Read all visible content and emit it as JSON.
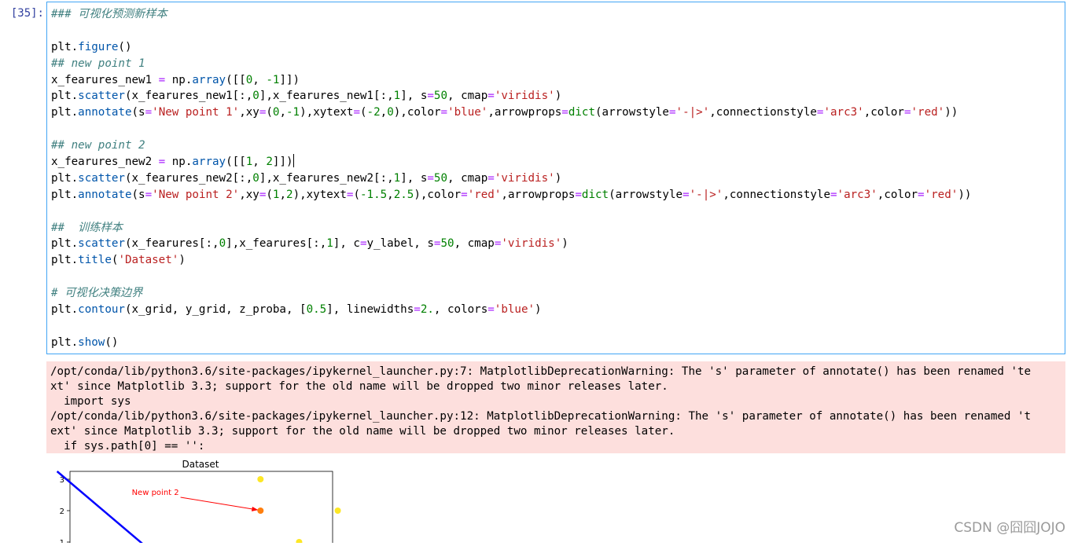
{
  "cell": {
    "prompt": "[35]:",
    "lines": [
      [
        {
          "t": "### 可视化预测新样本",
          "c": "cm"
        }
      ],
      [],
      [
        {
          "t": "plt.",
          "c": ""
        },
        {
          "t": "figure",
          "c": "fn"
        },
        {
          "t": "()",
          "c": ""
        }
      ],
      [
        {
          "t": "## new point 1",
          "c": "cm"
        }
      ],
      [
        {
          "t": "x_fearures_new1 ",
          "c": ""
        },
        {
          "t": "=",
          "c": "op"
        },
        {
          "t": " np.",
          "c": ""
        },
        {
          "t": "array",
          "c": "fn"
        },
        {
          "t": "([[",
          "c": ""
        },
        {
          "t": "0",
          "c": "num"
        },
        {
          "t": ", ",
          "c": ""
        },
        {
          "t": "-1",
          "c": "num"
        },
        {
          "t": "]])",
          "c": ""
        }
      ],
      [
        {
          "t": "plt.",
          "c": ""
        },
        {
          "t": "scatter",
          "c": "fn"
        },
        {
          "t": "(x_fearures_new1[:,",
          "c": ""
        },
        {
          "t": "0",
          "c": "num"
        },
        {
          "t": "],x_fearures_new1[:,",
          "c": ""
        },
        {
          "t": "1",
          "c": "num"
        },
        {
          "t": "], s",
          "c": ""
        },
        {
          "t": "=",
          "c": "op"
        },
        {
          "t": "50",
          "c": "num"
        },
        {
          "t": ", cmap",
          "c": ""
        },
        {
          "t": "=",
          "c": "op"
        },
        {
          "t": "'viridis'",
          "c": "str"
        },
        {
          "t": ")",
          "c": ""
        }
      ],
      [
        {
          "t": "plt.",
          "c": ""
        },
        {
          "t": "annotate",
          "c": "fn"
        },
        {
          "t": "(s",
          "c": ""
        },
        {
          "t": "=",
          "c": "op"
        },
        {
          "t": "'New point 1'",
          "c": "str"
        },
        {
          "t": ",xy",
          "c": ""
        },
        {
          "t": "=",
          "c": "op"
        },
        {
          "t": "(",
          "c": ""
        },
        {
          "t": "0",
          "c": "num"
        },
        {
          "t": ",",
          "c": ""
        },
        {
          "t": "-1",
          "c": "num"
        },
        {
          "t": "),xytext",
          "c": ""
        },
        {
          "t": "=",
          "c": "op"
        },
        {
          "t": "(",
          "c": ""
        },
        {
          "t": "-2",
          "c": "num"
        },
        {
          "t": ",",
          "c": ""
        },
        {
          "t": "0",
          "c": "num"
        },
        {
          "t": "),color",
          "c": ""
        },
        {
          "t": "=",
          "c": "op"
        },
        {
          "t": "'blue'",
          "c": "str"
        },
        {
          "t": ",arrowprops",
          "c": ""
        },
        {
          "t": "=",
          "c": "op"
        },
        {
          "t": "dict",
          "c": "kw"
        },
        {
          "t": "(arrowstyle",
          "c": ""
        },
        {
          "t": "=",
          "c": "op"
        },
        {
          "t": "'-|>'",
          "c": "str"
        },
        {
          "t": ",connectionstyle",
          "c": ""
        },
        {
          "t": "=",
          "c": "op"
        },
        {
          "t": "'arc3'",
          "c": "str"
        },
        {
          "t": ",color",
          "c": ""
        },
        {
          "t": "=",
          "c": "op"
        },
        {
          "t": "'red'",
          "c": "str"
        },
        {
          "t": "))",
          "c": ""
        }
      ],
      [],
      [
        {
          "t": "## new point 2",
          "c": "cm"
        }
      ],
      [
        {
          "t": "x_fearures_new2 ",
          "c": ""
        },
        {
          "t": "=",
          "c": "op"
        },
        {
          "t": " np.",
          "c": ""
        },
        {
          "t": "array",
          "c": "fn"
        },
        {
          "t": "([[",
          "c": ""
        },
        {
          "t": "1",
          "c": "num"
        },
        {
          "t": ", ",
          "c": ""
        },
        {
          "t": "2",
          "c": "num"
        },
        {
          "t": "]])",
          "c": ""
        },
        {
          "t": "",
          "c": "cursor"
        }
      ],
      [
        {
          "t": "plt.",
          "c": ""
        },
        {
          "t": "scatter",
          "c": "fn"
        },
        {
          "t": "(x_fearures_new2[:,",
          "c": ""
        },
        {
          "t": "0",
          "c": "num"
        },
        {
          "t": "],x_fearures_new2[:,",
          "c": ""
        },
        {
          "t": "1",
          "c": "num"
        },
        {
          "t": "], s",
          "c": ""
        },
        {
          "t": "=",
          "c": "op"
        },
        {
          "t": "50",
          "c": "num"
        },
        {
          "t": ", cmap",
          "c": ""
        },
        {
          "t": "=",
          "c": "op"
        },
        {
          "t": "'viridis'",
          "c": "str"
        },
        {
          "t": ")",
          "c": ""
        }
      ],
      [
        {
          "t": "plt.",
          "c": ""
        },
        {
          "t": "annotate",
          "c": "fn"
        },
        {
          "t": "(s",
          "c": ""
        },
        {
          "t": "=",
          "c": "op"
        },
        {
          "t": "'New point 2'",
          "c": "str"
        },
        {
          "t": ",xy",
          "c": ""
        },
        {
          "t": "=",
          "c": "op"
        },
        {
          "t": "(",
          "c": ""
        },
        {
          "t": "1",
          "c": "num"
        },
        {
          "t": ",",
          "c": ""
        },
        {
          "t": "2",
          "c": "num"
        },
        {
          "t": "),xytext",
          "c": ""
        },
        {
          "t": "=",
          "c": "op"
        },
        {
          "t": "(",
          "c": ""
        },
        {
          "t": "-1.5",
          "c": "num"
        },
        {
          "t": ",",
          "c": ""
        },
        {
          "t": "2.5",
          "c": "num"
        },
        {
          "t": "),color",
          "c": ""
        },
        {
          "t": "=",
          "c": "op"
        },
        {
          "t": "'red'",
          "c": "str"
        },
        {
          "t": ",arrowprops",
          "c": ""
        },
        {
          "t": "=",
          "c": "op"
        },
        {
          "t": "dict",
          "c": "kw"
        },
        {
          "t": "(arrowstyle",
          "c": ""
        },
        {
          "t": "=",
          "c": "op"
        },
        {
          "t": "'-|>'",
          "c": "str"
        },
        {
          "t": ",connectionstyle",
          "c": ""
        },
        {
          "t": "=",
          "c": "op"
        },
        {
          "t": "'arc3'",
          "c": "str"
        },
        {
          "t": ",color",
          "c": ""
        },
        {
          "t": "=",
          "c": "op"
        },
        {
          "t": "'red'",
          "c": "str"
        },
        {
          "t": "))",
          "c": ""
        }
      ],
      [],
      [
        {
          "t": "##  训练样本",
          "c": "cm"
        }
      ],
      [
        {
          "t": "plt.",
          "c": ""
        },
        {
          "t": "scatter",
          "c": "fn"
        },
        {
          "t": "(x_fearures[:,",
          "c": ""
        },
        {
          "t": "0",
          "c": "num"
        },
        {
          "t": "],x_fearures[:,",
          "c": ""
        },
        {
          "t": "1",
          "c": "num"
        },
        {
          "t": "], c",
          "c": ""
        },
        {
          "t": "=",
          "c": "op"
        },
        {
          "t": "y_label, s",
          "c": ""
        },
        {
          "t": "=",
          "c": "op"
        },
        {
          "t": "50",
          "c": "num"
        },
        {
          "t": ", cmap",
          "c": ""
        },
        {
          "t": "=",
          "c": "op"
        },
        {
          "t": "'viridis'",
          "c": "str"
        },
        {
          "t": ")",
          "c": ""
        }
      ],
      [
        {
          "t": "plt.",
          "c": ""
        },
        {
          "t": "title",
          "c": "fn"
        },
        {
          "t": "(",
          "c": ""
        },
        {
          "t": "'Dataset'",
          "c": "str"
        },
        {
          "t": ")",
          "c": ""
        }
      ],
      [],
      [
        {
          "t": "# 可视化决策边界",
          "c": "cm"
        }
      ],
      [
        {
          "t": "plt.",
          "c": ""
        },
        {
          "t": "contour",
          "c": "fn"
        },
        {
          "t": "(x_grid, y_grid, z_proba, [",
          "c": ""
        },
        {
          "t": "0.5",
          "c": "num"
        },
        {
          "t": "], linewidths",
          "c": ""
        },
        {
          "t": "=",
          "c": "op"
        },
        {
          "t": "2.",
          "c": "num"
        },
        {
          "t": ", colors",
          "c": ""
        },
        {
          "t": "=",
          "c": "op"
        },
        {
          "t": "'blue'",
          "c": "str"
        },
        {
          "t": ")",
          "c": ""
        }
      ],
      [],
      [
        {
          "t": "plt.",
          "c": ""
        },
        {
          "t": "show",
          "c": "fn"
        },
        {
          "t": "()",
          "c": ""
        }
      ]
    ]
  },
  "stderr": {
    "lines": [
      "/opt/conda/lib/python3.6/site-packages/ipykernel_launcher.py:7: MatplotlibDeprecationWarning: The 's' parameter of annotate() has been renamed 'te",
      "xt' since Matplotlib 3.3; support for the old name will be dropped two minor releases later.",
      "  import sys",
      "/opt/conda/lib/python3.6/site-packages/ipykernel_launcher.py:12: MatplotlibDeprecationWarning: The 's' parameter of annotate() has been renamed 't",
      "ext' since Matplotlib 3.3; support for the old name will be dropped two minor releases later.",
      "  if sys.path[0] == '':"
    ]
  },
  "chart_data": {
    "type": "scatter",
    "title": "Dataset",
    "xlabel": "",
    "ylabel": "",
    "xlim": [
      -2.7,
      2.4
    ],
    "ylim": [
      0.75,
      3.25
    ],
    "yticks": [
      "1",
      "2",
      "3"
    ],
    "points": [
      {
        "x": 1,
        "y": 3,
        "color": "#fde725"
      },
      {
        "x": 2.5,
        "y": 2,
        "color": "#fde725"
      },
      {
        "x": 1.75,
        "y": 1,
        "color": "#fde725"
      },
      {
        "x": 1,
        "y": 2,
        "color": "#ff7f0e"
      }
    ],
    "decision_boundary": {
      "color": "#0000ff",
      "from": [
        -2.95,
        3.25
      ],
      "to": [
        -1.15,
        0.75
      ]
    },
    "annotation": {
      "text": "New point 2",
      "xytext": [
        -1.5,
        2.5
      ],
      "xy": [
        1,
        2
      ],
      "text_color": "#ff0000",
      "arrow_color": "#ff0000"
    }
  },
  "watermark": "CSDN @囧囧JOJO"
}
